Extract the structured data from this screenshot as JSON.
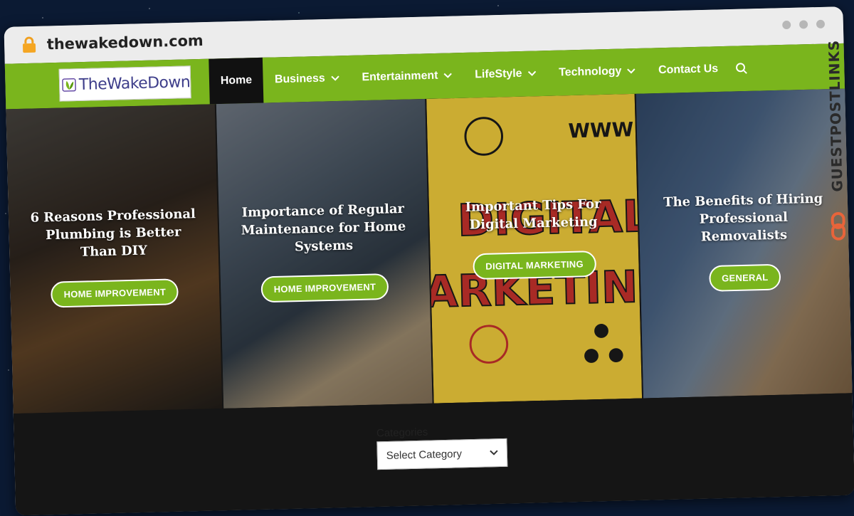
{
  "browser": {
    "url": "thewakedown.com"
  },
  "header": {
    "logo_text": "TheWakeDown",
    "menu": [
      {
        "label": "Home",
        "active": true,
        "has_dropdown": false
      },
      {
        "label": "Business",
        "active": false,
        "has_dropdown": true
      },
      {
        "label": "Entertainment",
        "active": false,
        "has_dropdown": true
      },
      {
        "label": "LifeStyle",
        "active": false,
        "has_dropdown": true
      },
      {
        "label": "Technology",
        "active": false,
        "has_dropdown": true
      },
      {
        "label": "Contact Us",
        "active": false,
        "has_dropdown": false
      }
    ],
    "search_icon": "search-icon",
    "accent_color": "#7ab51d"
  },
  "slides": [
    {
      "title": "6 Reasons Professional Plumbing is Better Than DIY",
      "category": "HOME IMPROVEMENT"
    },
    {
      "title": "Importance of Regular Maintenance for Home Systems",
      "category": "HOME IMPROVEMENT"
    },
    {
      "title": "Important Tips For Digital Marketing",
      "category": "DIGITAL MARKETING"
    },
    {
      "title": "The Benefits of Hiring Professional Removalists",
      "category": "GENERAL"
    }
  ],
  "sidebar_brand": "GUESTPOSTLINKS",
  "categories_widget": {
    "label": "Categories",
    "selected": "Select Category"
  }
}
